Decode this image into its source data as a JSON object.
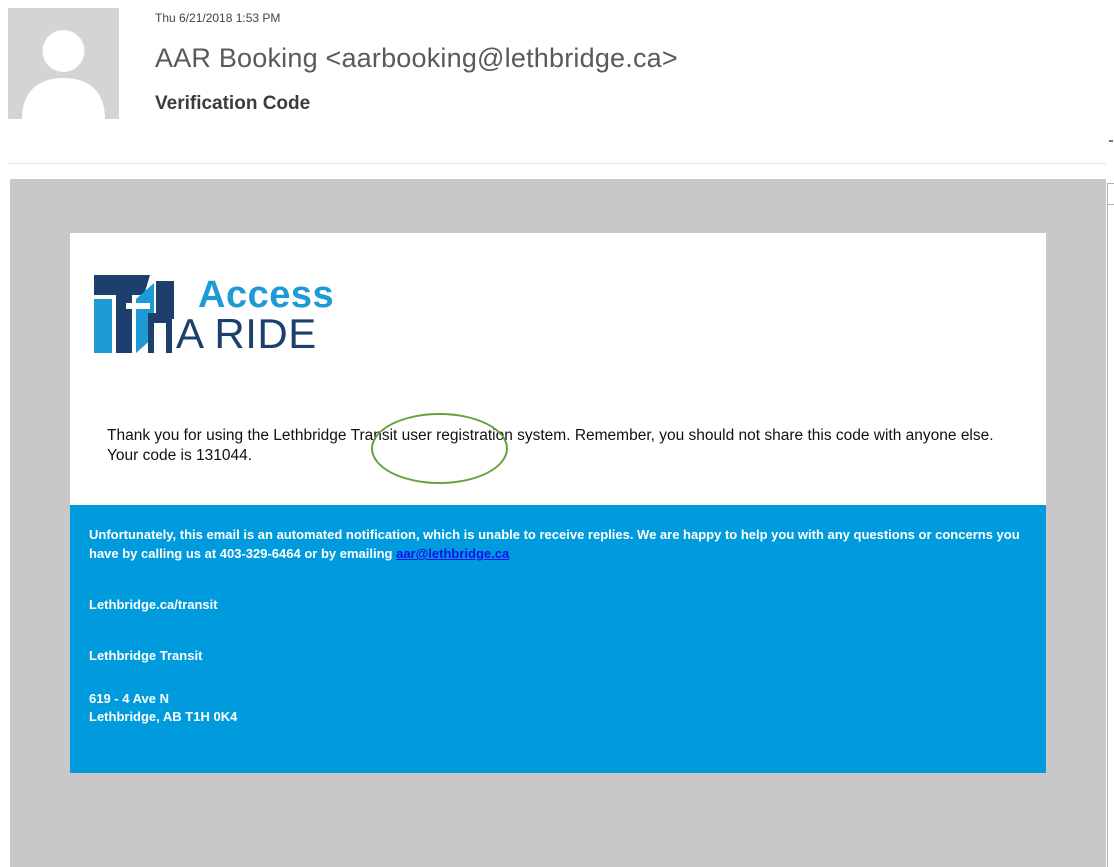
{
  "header": {
    "date": "Thu 6/21/2018 1:53 PM",
    "from": "AAR Booking <aarbooking@lethbridge.ca>",
    "subject": "Verification Code",
    "avatar_icon": "person-silhouette-icon"
  },
  "email": {
    "logo": {
      "line1": "Access",
      "line2": "A RIDE",
      "icon": "access-a-ride-logo-icon"
    },
    "message_before_code": "Thank you for using the Lethbridge Transit user registration system. Remember, you should not share this code with anyone else. Your code is ",
    "code": "131044",
    "message_after_code": ".",
    "footer": {
      "notice_text": "Unfortunately, this email is an automated notification, which is unable to receive replies. We are happy to help you with any questions or concerns you have by calling us at 403-329-6464 or by emailing ",
      "notice_link": "aar@lethbridge.ca",
      "site": "Lethbridge.ca/transit",
      "org": "Lethbridge Transit",
      "address_line1": "619 - 4 Ave N",
      "address_line2": "Lethbridge, AB T1H 0K4"
    }
  },
  "colors": {
    "footer_bg": "#009bdd",
    "logo_blue": "#1e9ad6",
    "logo_navy": "#1c3f6e",
    "highlight": "#62a43a",
    "frame_gray": "#c8c8c8"
  }
}
